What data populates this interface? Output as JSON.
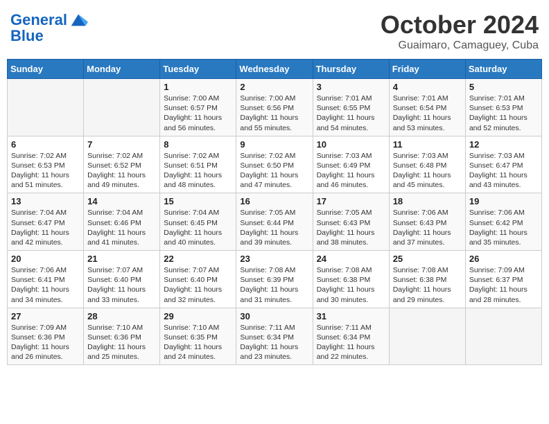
{
  "logo": {
    "line1": "General",
    "line2": "Blue"
  },
  "title": "October 2024",
  "subtitle": "Guaimaro, Camaguey, Cuba",
  "days_of_week": [
    "Sunday",
    "Monday",
    "Tuesday",
    "Wednesday",
    "Thursday",
    "Friday",
    "Saturday"
  ],
  "weeks": [
    [
      {
        "day": "",
        "info": ""
      },
      {
        "day": "",
        "info": ""
      },
      {
        "day": "1",
        "info": "Sunrise: 7:00 AM\nSunset: 6:57 PM\nDaylight: 11 hours and 56 minutes."
      },
      {
        "day": "2",
        "info": "Sunrise: 7:00 AM\nSunset: 6:56 PM\nDaylight: 11 hours and 55 minutes."
      },
      {
        "day": "3",
        "info": "Sunrise: 7:01 AM\nSunset: 6:55 PM\nDaylight: 11 hours and 54 minutes."
      },
      {
        "day": "4",
        "info": "Sunrise: 7:01 AM\nSunset: 6:54 PM\nDaylight: 11 hours and 53 minutes."
      },
      {
        "day": "5",
        "info": "Sunrise: 7:01 AM\nSunset: 6:53 PM\nDaylight: 11 hours and 52 minutes."
      }
    ],
    [
      {
        "day": "6",
        "info": "Sunrise: 7:02 AM\nSunset: 6:53 PM\nDaylight: 11 hours and 51 minutes."
      },
      {
        "day": "7",
        "info": "Sunrise: 7:02 AM\nSunset: 6:52 PM\nDaylight: 11 hours and 49 minutes."
      },
      {
        "day": "8",
        "info": "Sunrise: 7:02 AM\nSunset: 6:51 PM\nDaylight: 11 hours and 48 minutes."
      },
      {
        "day": "9",
        "info": "Sunrise: 7:02 AM\nSunset: 6:50 PM\nDaylight: 11 hours and 47 minutes."
      },
      {
        "day": "10",
        "info": "Sunrise: 7:03 AM\nSunset: 6:49 PM\nDaylight: 11 hours and 46 minutes."
      },
      {
        "day": "11",
        "info": "Sunrise: 7:03 AM\nSunset: 6:48 PM\nDaylight: 11 hours and 45 minutes."
      },
      {
        "day": "12",
        "info": "Sunrise: 7:03 AM\nSunset: 6:47 PM\nDaylight: 11 hours and 43 minutes."
      }
    ],
    [
      {
        "day": "13",
        "info": "Sunrise: 7:04 AM\nSunset: 6:47 PM\nDaylight: 11 hours and 42 minutes."
      },
      {
        "day": "14",
        "info": "Sunrise: 7:04 AM\nSunset: 6:46 PM\nDaylight: 11 hours and 41 minutes."
      },
      {
        "day": "15",
        "info": "Sunrise: 7:04 AM\nSunset: 6:45 PM\nDaylight: 11 hours and 40 minutes."
      },
      {
        "day": "16",
        "info": "Sunrise: 7:05 AM\nSunset: 6:44 PM\nDaylight: 11 hours and 39 minutes."
      },
      {
        "day": "17",
        "info": "Sunrise: 7:05 AM\nSunset: 6:43 PM\nDaylight: 11 hours and 38 minutes."
      },
      {
        "day": "18",
        "info": "Sunrise: 7:06 AM\nSunset: 6:43 PM\nDaylight: 11 hours and 37 minutes."
      },
      {
        "day": "19",
        "info": "Sunrise: 7:06 AM\nSunset: 6:42 PM\nDaylight: 11 hours and 35 minutes."
      }
    ],
    [
      {
        "day": "20",
        "info": "Sunrise: 7:06 AM\nSunset: 6:41 PM\nDaylight: 11 hours and 34 minutes."
      },
      {
        "day": "21",
        "info": "Sunrise: 7:07 AM\nSunset: 6:40 PM\nDaylight: 11 hours and 33 minutes."
      },
      {
        "day": "22",
        "info": "Sunrise: 7:07 AM\nSunset: 6:40 PM\nDaylight: 11 hours and 32 minutes."
      },
      {
        "day": "23",
        "info": "Sunrise: 7:08 AM\nSunset: 6:39 PM\nDaylight: 11 hours and 31 minutes."
      },
      {
        "day": "24",
        "info": "Sunrise: 7:08 AM\nSunset: 6:38 PM\nDaylight: 11 hours and 30 minutes."
      },
      {
        "day": "25",
        "info": "Sunrise: 7:08 AM\nSunset: 6:38 PM\nDaylight: 11 hours and 29 minutes."
      },
      {
        "day": "26",
        "info": "Sunrise: 7:09 AM\nSunset: 6:37 PM\nDaylight: 11 hours and 28 minutes."
      }
    ],
    [
      {
        "day": "27",
        "info": "Sunrise: 7:09 AM\nSunset: 6:36 PM\nDaylight: 11 hours and 26 minutes."
      },
      {
        "day": "28",
        "info": "Sunrise: 7:10 AM\nSunset: 6:36 PM\nDaylight: 11 hours and 25 minutes."
      },
      {
        "day": "29",
        "info": "Sunrise: 7:10 AM\nSunset: 6:35 PM\nDaylight: 11 hours and 24 minutes."
      },
      {
        "day": "30",
        "info": "Sunrise: 7:11 AM\nSunset: 6:34 PM\nDaylight: 11 hours and 23 minutes."
      },
      {
        "day": "31",
        "info": "Sunrise: 7:11 AM\nSunset: 6:34 PM\nDaylight: 11 hours and 22 minutes."
      },
      {
        "day": "",
        "info": ""
      },
      {
        "day": "",
        "info": ""
      }
    ]
  ]
}
